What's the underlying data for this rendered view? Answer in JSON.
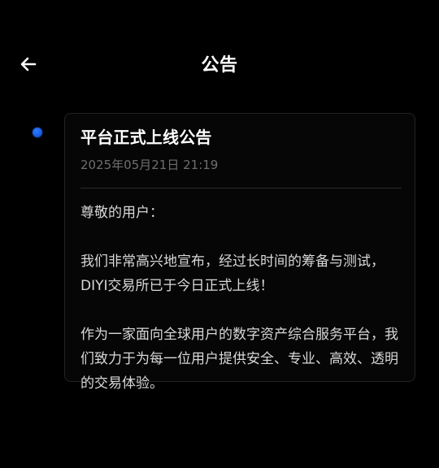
{
  "header": {
    "title": "公告",
    "back_icon": "arrow-left-icon"
  },
  "timeline": {
    "dot_color": "#1a5fe6"
  },
  "announcement": {
    "title": "平台正式上线公告",
    "timestamp": "2025年05月21日 21:19",
    "greeting": "尊敬的用户：",
    "paragraph1": "我们非常高兴地宣布，经过长时间的筹备与测试，DIYI交易所已于今日正式上线！",
    "paragraph2": "作为一家面向全球用户的数字资产综合服务平台，我们致力于为每一位用户提供安全、专业、高效、透明的交易体验。"
  },
  "colors": {
    "background": "#000000",
    "card_border": "#232323",
    "text_primary": "#ffffff",
    "text_secondary": "#6e6e6e",
    "text_body": "#d8d8d8"
  }
}
